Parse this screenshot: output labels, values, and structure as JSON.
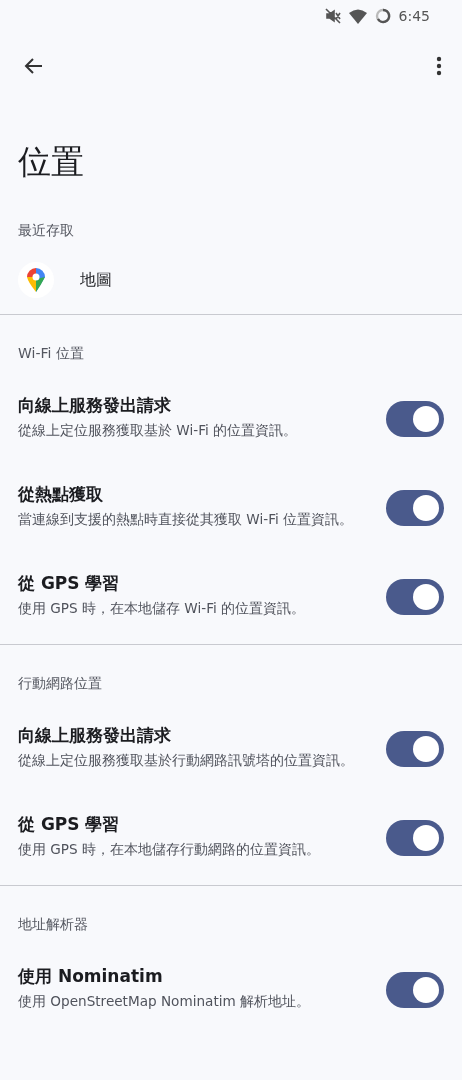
{
  "status_bar": {
    "time": "6:45"
  },
  "title": "位置",
  "recent_access": {
    "header": "最近存取",
    "apps": [
      {
        "name": "地圖"
      }
    ]
  },
  "sections": [
    {
      "header": "Wi-Fi 位置",
      "rows": [
        {
          "title": "向線上服務發出請求",
          "subtitle": "從線上定位服務獲取基於 Wi-Fi 的位置資訊。",
          "on": true
        },
        {
          "title": "從熱點獲取",
          "subtitle": "當連線到支援的熱點時直接從其獲取 Wi-Fi 位置資訊。",
          "on": true
        },
        {
          "title": "從 GPS 學習",
          "subtitle": "使用 GPS 時，在本地儲存 Wi-Fi 的位置資訊。",
          "on": true
        }
      ]
    },
    {
      "header": "行動網路位置",
      "rows": [
        {
          "title": "向線上服務發出請求",
          "subtitle": "從線上定位服務獲取基於行動網路訊號塔的位置資訊。",
          "on": true
        },
        {
          "title": "從 GPS 學習",
          "subtitle": "使用 GPS 時，在本地儲存行動網路的位置資訊。",
          "on": true
        }
      ]
    },
    {
      "header": "地址解析器",
      "rows": [
        {
          "title": "使用 Nominatim",
          "subtitle": "使用 OpenStreetMap Nominatim 解析地址。",
          "on": true
        }
      ]
    }
  ]
}
